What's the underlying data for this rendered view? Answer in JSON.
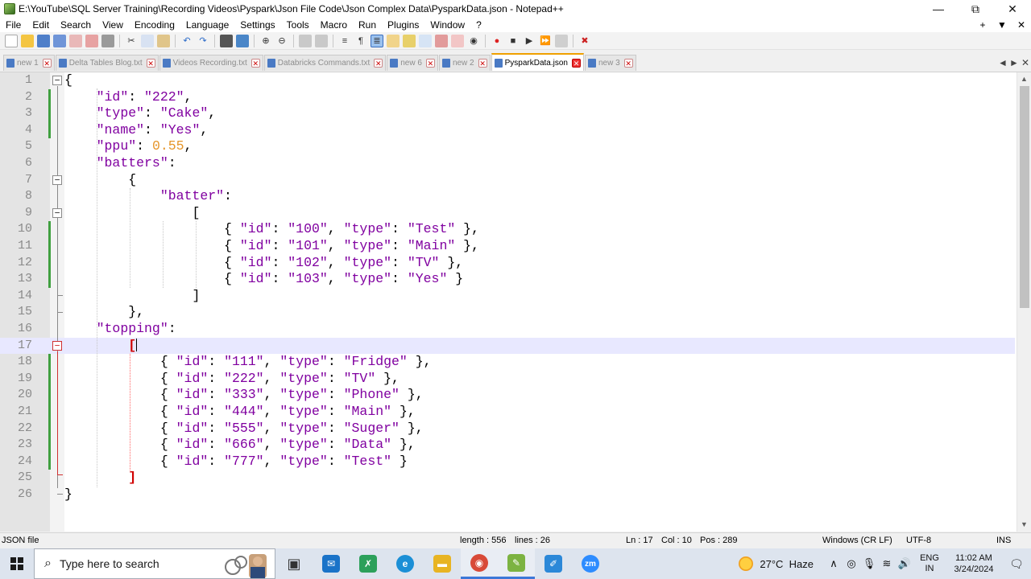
{
  "window": {
    "title": "E:\\YouTube\\SQL Server Training\\Recording Videos\\Pyspark\\Json File Code\\Json Complex Data\\PysparkData.json - Notepad++",
    "minimize": "—",
    "maximize": "⧉",
    "close": "✕"
  },
  "menu": {
    "items": [
      "File",
      "Edit",
      "Search",
      "View",
      "Encoding",
      "Language",
      "Settings",
      "Tools",
      "Macro",
      "Run",
      "Plugins",
      "Window",
      "?"
    ],
    "right": [
      "+",
      "▼",
      "✕"
    ]
  },
  "tabs": [
    {
      "label": "new 1",
      "active": false
    },
    {
      "label": "Delta Tables Blog.txt",
      "active": false
    },
    {
      "label": "Videos Recording.txt",
      "active": false
    },
    {
      "label": "Databricks Commands.txt",
      "active": false
    },
    {
      "label": "new 6",
      "active": false
    },
    {
      "label": "new 2",
      "active": false
    },
    {
      "label": "PysparkData.json",
      "active": true
    },
    {
      "label": "new 3",
      "active": false
    }
  ],
  "tab_close": "✕",
  "tab_nav": [
    "◄",
    "►",
    "✕"
  ],
  "editor": {
    "line_numbers": [
      "1",
      "2",
      "3",
      "4",
      "5",
      "6",
      "7",
      "8",
      "9",
      "10",
      "11",
      "12",
      "13",
      "14",
      "15",
      "16",
      "17",
      "18",
      "19",
      "20",
      "21",
      "22",
      "23",
      "24",
      "25",
      "26"
    ],
    "lines": [
      "{",
      "    \"id\": \"222\",",
      "    \"type\": \"Cake\",",
      "    \"name\": \"Yes\",",
      "    \"ppu\": 0.55,",
      "    \"batters\":",
      "        {",
      "            \"batter\":",
      "                [",
      "                    { \"id\": \"100\", \"type\": \"Test\" },",
      "                    { \"id\": \"101\", \"type\": \"Main\" },",
      "                    { \"id\": \"102\", \"type\": \"TV\" },",
      "                    { \"id\": \"103\", \"type\": \"Yes\" }",
      "                ]",
      "        },",
      "    \"topping\":",
      "        [",
      "            { \"id\": \"111\", \"type\": \"Fridge\" },",
      "            { \"id\": \"222\", \"type\": \"TV\" },",
      "            { \"id\": \"333\", \"type\": \"Phone\" },",
      "            { \"id\": \"444\", \"type\": \"Main\" },",
      "            { \"id\": \"555\", \"type\": \"Suger\" },",
      "            { \"id\": \"666\", \"type\": \"Data\" },",
      "            { \"id\": \"777\", \"type\": \"Test\" }",
      "        ]",
      "}"
    ],
    "current_line": 17
  },
  "status": {
    "file_type": "JSON file",
    "length": "length : 556",
    "lines": "lines : 26",
    "ln": "Ln : 17",
    "col": "Col : 10",
    "pos": "Pos : 289",
    "eol": "Windows (CR LF)",
    "encoding": "UTF-8",
    "mode": "INS"
  },
  "taskbar": {
    "search_placeholder": "Type here to search",
    "weather_temp": "27°C",
    "weather_desc": "Haze",
    "lang_top": "ENG",
    "lang_bottom": "IN",
    "time": "11:02 AM",
    "date": "3/24/2024",
    "apps": [
      {
        "name": "task-view",
        "glyph": "▣",
        "color": "#333333"
      },
      {
        "name": "mail",
        "glyph": "✉",
        "color": "#1a73c8"
      },
      {
        "name": "vscode",
        "glyph": "✗",
        "color": "#2ca05a"
      },
      {
        "name": "edge",
        "glyph": "e",
        "color": "#1b8fd6"
      },
      {
        "name": "file-explorer",
        "glyph": "▬",
        "color": "#e8b423"
      },
      {
        "name": "chrome",
        "glyph": "◉",
        "color": "#d84a38"
      },
      {
        "name": "notepad-plus-plus",
        "glyph": "✎",
        "color": "#7cb342"
      },
      {
        "name": "paint",
        "glyph": "✐",
        "color": "#2b88d8"
      },
      {
        "name": "zoom",
        "glyph": "zm",
        "color": "#2d8cff"
      }
    ]
  }
}
